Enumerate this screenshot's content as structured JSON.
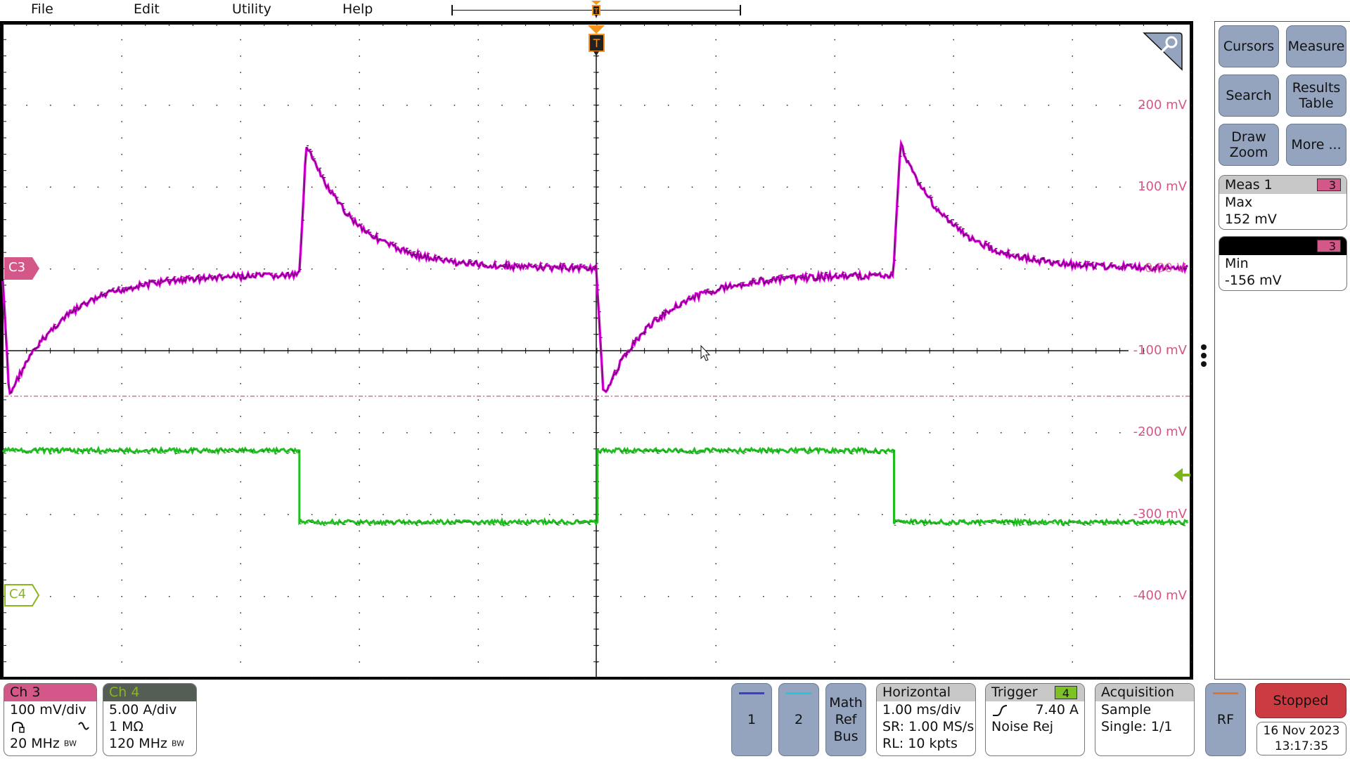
{
  "menu": {
    "items": [
      "File",
      "Edit",
      "Utility",
      "Help"
    ]
  },
  "trigger_marker_label": "T",
  "y_axis_labels": [
    "200 mV",
    "100 mV",
    "0.00 V",
    "-100 mV",
    "-200 mV",
    "-300 mV",
    "-400 mV"
  ],
  "channel_markers": {
    "c3": "C3",
    "c4": "C4"
  },
  "colors": {
    "ch3": "#d4578a",
    "ch3_trace": "#cc00cc",
    "ch4": "#8ab51e",
    "ch4_trace": "#22cc22",
    "trigger": "#f7941d",
    "button": "#94a4bf",
    "stopped": "#cc3b42"
  },
  "right_panel": {
    "buttons": [
      "Cursors",
      "Measure",
      "Search",
      "Results Table",
      "Draw Zoom",
      "More ..."
    ],
    "measurements": [
      {
        "title": "Meas 1",
        "channel": "3",
        "type": "Max",
        "value": "152 mV"
      },
      {
        "title": "",
        "channel": "3",
        "type": "Min",
        "value": "-156 mV"
      }
    ]
  },
  "bottom_bar": {
    "ch3": {
      "title": "Ch 3",
      "scale": "100 mV/div",
      "bandwidth": "20 MHz"
    },
    "ch4": {
      "title": "Ch 4",
      "scale": "5.00 A/div",
      "impedance": "1 MΩ",
      "bandwidth": "120 MHz"
    },
    "bw_symbol": "BW",
    "buttons": {
      "ch1": "1",
      "ch2": "2",
      "math": "Math Ref Bus",
      "rf": "RF"
    },
    "horizontal": {
      "title": "Horizontal",
      "scale": "1.00 ms/div",
      "sample_rate": "SR: 1.00 MS/s",
      "record_length": "RL: 10 kpts"
    },
    "trigger": {
      "title": "Trigger",
      "source": "4",
      "level": "7.40 A",
      "mode": "Noise Rej"
    },
    "acquisition": {
      "title": "Acquisition",
      "mode": "Sample",
      "count": "Single: 1/1"
    },
    "run_state": "Stopped",
    "date": "16 Nov 2023",
    "time": "13:17:35"
  },
  "waveforms": {
    "ch3": {
      "units": "mV",
      "scale_per_div": 100,
      "max": 152,
      "min": -156,
      "period_ms": 5.0,
      "transitions_ms": [
        -4.98,
        -2.5,
        0.0,
        2.5
      ]
    },
    "ch4": {
      "units": "A",
      "scale_per_div": 5.0,
      "high_offset_divs": 0,
      "transitions_ms": [
        -2.5,
        0.0,
        2.5
      ]
    },
    "min_reference_mV": -156
  }
}
